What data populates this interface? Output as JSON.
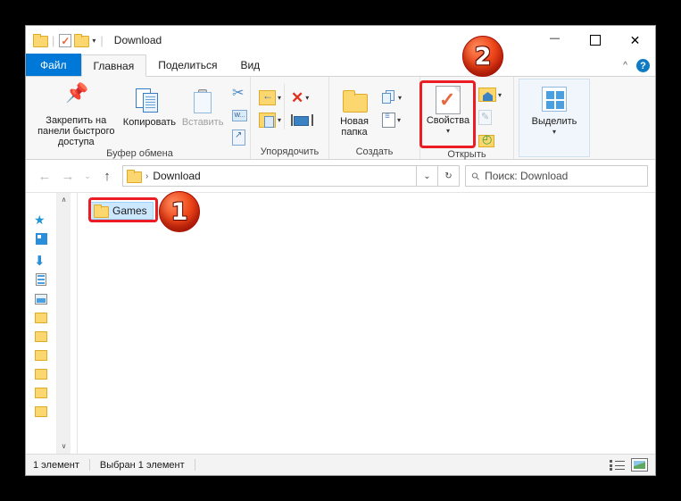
{
  "window": {
    "title": "Download",
    "quick_access": {
      "folder_icon": "folder-icon",
      "properties_icon": "properties-checkmark-icon",
      "new_folder_icon": "folder-icon",
      "customize_caret": "▾"
    },
    "controls": {
      "minimize": "—",
      "maximize": "□",
      "close": "✕"
    }
  },
  "ribbon": {
    "tabs": [
      {
        "label": "Файл",
        "state": "file"
      },
      {
        "label": "Главная",
        "state": "active"
      },
      {
        "label": "Поделиться",
        "state": "normal"
      },
      {
        "label": "Вид",
        "state": "normal"
      }
    ],
    "collapse_icon": "chevron-up-icon",
    "help_icon": "help-icon",
    "help_glyph": "?",
    "groups": [
      {
        "name": "Буфер обмена",
        "buttons": {
          "pin": "Закрепить на панели быстрого доступа",
          "copy": "Копировать",
          "paste": "Вставить",
          "cut": "Вырезать",
          "copy_path": "Копировать путь",
          "paste_shortcut": "Вставить ярлык"
        }
      },
      {
        "name": "Упорядочить",
        "buttons": {
          "move_to": "Переместить в",
          "copy_to": "Копировать в",
          "delete": "Удалить",
          "rename": "Переименовать"
        }
      },
      {
        "name": "Создать",
        "buttons": {
          "new_folder": "Новая папка",
          "new_item": "Создать элемент",
          "easy_access": "Простой доступ"
        }
      },
      {
        "name": "Открыть",
        "buttons": {
          "properties": "Свойства",
          "properties_caret": "▾",
          "open_with": "Открыть",
          "edit": "Изменить",
          "history": "Журнал"
        }
      },
      {
        "name": "",
        "buttons": {
          "select": "Выделить",
          "select_caret": "▾"
        }
      }
    ]
  },
  "addressbar": {
    "back": "←",
    "forward": "→",
    "recent": "⌄",
    "up": "↑",
    "crumb_folder_icon": "folder-icon",
    "crumb_separator": "›",
    "crumb": "Download",
    "dropdown": "⌄",
    "refresh": "↻",
    "search_icon": "search-icon",
    "search_placeholder": "Поиск: Download"
  },
  "navpane": {
    "scroll_up": "∧",
    "scroll_down": "∨",
    "items": [
      {
        "icon": "quick-access-star-icon"
      },
      {
        "icon": "onedrive-icon"
      },
      {
        "icon": "downloads-icon"
      },
      {
        "icon": "documents-icon"
      },
      {
        "icon": "pictures-icon"
      },
      {
        "icon": "folder-icon"
      },
      {
        "icon": "folder-icon"
      },
      {
        "icon": "folder-icon"
      },
      {
        "icon": "folder-icon"
      },
      {
        "icon": "folder-icon"
      },
      {
        "icon": "folder-icon"
      }
    ]
  },
  "filelist": {
    "items": [
      {
        "name": "Games",
        "icon": "folder-icon",
        "selected": true
      }
    ]
  },
  "statusbar": {
    "count": "1 элемент",
    "selection": "Выбран 1 элемент",
    "details_view_icon": "details-view-icon",
    "large_icons_view_icon": "large-icons-view-icon"
  },
  "annotations": {
    "step1": "1",
    "step2": "2",
    "highlight_color": "#ec1c24"
  }
}
